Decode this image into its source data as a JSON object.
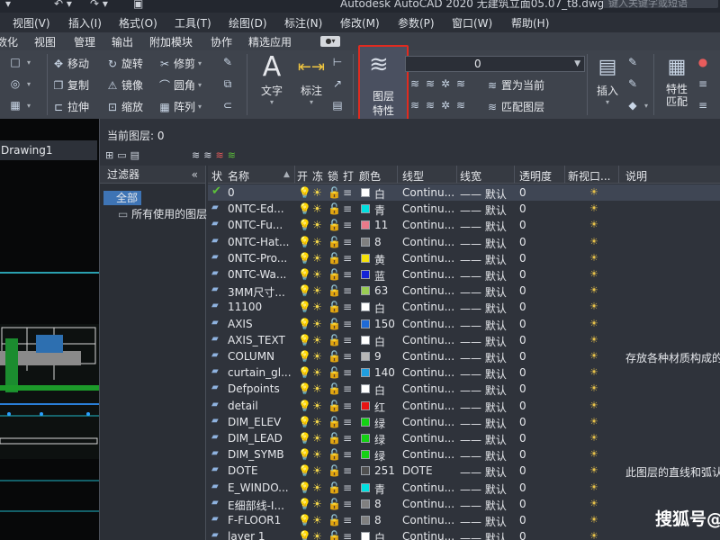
{
  "window": {
    "title": "Autodesk AutoCAD 2020    无建筑立面05.07_t8.dwg",
    "search_placeholder": "键入关键字或短语"
  },
  "menu": [
    "视图(V)",
    "插入(I)",
    "格式(O)",
    "工具(T)",
    "绘图(D)",
    "标注(N)",
    "修改(M)",
    "参数(P)",
    "窗口(W)",
    "帮助(H)"
  ],
  "ribbon_tabs": [
    "数化",
    "视图",
    "管理",
    "输出",
    "附加模块",
    "协作",
    "精选应用"
  ],
  "ribbon": {
    "modify": {
      "move": "移动",
      "rotate": "旋转",
      "trim": "修剪",
      "copy": "复制",
      "mirror": "镜像",
      "fillet": "圆角",
      "stretch": "拉伸",
      "scale": "缩放",
      "array": "阵列"
    },
    "annotation": {
      "text": "文字",
      "dimension": "标注"
    },
    "layers": {
      "layer_properties_line1": "图层",
      "layer_properties_line2": "特性",
      "layer_combo_value": "0",
      "set_current": "置为当前",
      "match_layer": "匹配图层"
    },
    "insert": "插入",
    "properties_line1": "特性",
    "properties_line2": "匹配"
  },
  "drawing_tab": "Drawing1",
  "layer_manager": {
    "current_layer": "当前图层: 0",
    "filters_header": "过滤器",
    "filter_all": "全部",
    "filter_used": "所有使用的图层",
    "columns": [
      "状",
      "名称",
      "开",
      "冻",
      "锁",
      "打",
      "颜色",
      "线型",
      "线宽",
      "透明度",
      "新视口...",
      "说明"
    ],
    "layers": [
      {
        "name": "0",
        "color": "白",
        "swatch": "#ffffff",
        "linetype": "Continu...",
        "lineweight": "—— 默认",
        "transparency": "0",
        "desc": "",
        "current": true
      },
      {
        "name": "0NTC-Ed...",
        "color": "青",
        "swatch": "#00e0e0",
        "linetype": "Continu...",
        "lineweight": "—— 默认",
        "transparency": "0",
        "desc": ""
      },
      {
        "name": "0NTC-Fu...",
        "color": "11",
        "swatch": "#e87a8a",
        "linetype": "Continu...",
        "lineweight": "—— 默认",
        "transparency": "0",
        "desc": ""
      },
      {
        "name": "0NTC-Hat...",
        "color": "8",
        "swatch": "#808080",
        "linetype": "Continu...",
        "lineweight": "—— 默认",
        "transparency": "0",
        "desc": ""
      },
      {
        "name": "0NTC-Pro...",
        "color": "黄",
        "swatch": "#f5e10a",
        "linetype": "Continu...",
        "lineweight": "—— 默认",
        "transparency": "0",
        "desc": ""
      },
      {
        "name": "0NTC-Wa...",
        "color": "蓝",
        "swatch": "#1424d6",
        "linetype": "Continu...",
        "lineweight": "—— 默认",
        "transparency": "0",
        "desc": ""
      },
      {
        "name": "3MM尺寸...",
        "color": "63",
        "swatch": "#9acd54",
        "linetype": "Continu...",
        "lineweight": "—— 默认",
        "transparency": "0",
        "desc": ""
      },
      {
        "name": "11100",
        "color": "白",
        "swatch": "#ffffff",
        "linetype": "Continu...",
        "lineweight": "—— 默认",
        "transparency": "0",
        "desc": ""
      },
      {
        "name": "AXIS",
        "color": "150",
        "swatch": "#1f6ad6",
        "linetype": "Continu...",
        "lineweight": "—— 默认",
        "transparency": "0",
        "desc": ""
      },
      {
        "name": "AXIS_TEXT",
        "color": "白",
        "swatch": "#ffffff",
        "linetype": "Continu...",
        "lineweight": "—— 默认",
        "transparency": "0",
        "desc": ""
      },
      {
        "name": "COLUMN",
        "color": "9",
        "swatch": "#b7b7b7",
        "linetype": "Continu...",
        "lineweight": "—— 默认",
        "transparency": "0",
        "desc": "存放各种材质构成的"
      },
      {
        "name": "curtain_gl...",
        "color": "140",
        "swatch": "#1f9ee0",
        "linetype": "Continu...",
        "lineweight": "—— 默认",
        "transparency": "0",
        "desc": ""
      },
      {
        "name": "Defpoints",
        "color": "白",
        "swatch": "#ffffff",
        "linetype": "Continu...",
        "lineweight": "—— 默认",
        "transparency": "0",
        "desc": ""
      },
      {
        "name": "detail",
        "color": "红",
        "swatch": "#e81414",
        "linetype": "Continu...",
        "lineweight": "—— 默认",
        "transparency": "0",
        "desc": ""
      },
      {
        "name": "DIM_ELEV",
        "color": "绿",
        "swatch": "#14d214",
        "linetype": "Continu...",
        "lineweight": "—— 默认",
        "transparency": "0",
        "desc": ""
      },
      {
        "name": "DIM_LEAD",
        "color": "绿",
        "swatch": "#14d214",
        "linetype": "Continu...",
        "lineweight": "—— 默认",
        "transparency": "0",
        "desc": ""
      },
      {
        "name": "DIM_SYMB",
        "color": "绿",
        "swatch": "#14d214",
        "linetype": "Continu...",
        "lineweight": "—— 默认",
        "transparency": "0",
        "desc": ""
      },
      {
        "name": "DOTE",
        "color": "251",
        "swatch": "#505050",
        "linetype": "DOTE",
        "lineweight": "—— 默认",
        "transparency": "0",
        "desc": "此图层的直线和弧认"
      },
      {
        "name": "E_WINDO...",
        "color": "青",
        "swatch": "#00e0e0",
        "linetype": "Continu...",
        "lineweight": "—— 默认",
        "transparency": "0",
        "desc": ""
      },
      {
        "name": "E细部线-I...",
        "color": "8",
        "swatch": "#808080",
        "linetype": "Continu...",
        "lineweight": "—— 默认",
        "transparency": "0",
        "desc": ""
      },
      {
        "name": "F-FLOOR1",
        "color": "8",
        "swatch": "#808080",
        "linetype": "Continu...",
        "lineweight": "—— 默认",
        "transparency": "0",
        "desc": ""
      },
      {
        "name": "layer 1",
        "color": "白",
        "swatch": "#ffffff",
        "linetype": "Continu...",
        "lineweight": "—— 默认",
        "transparency": "0",
        "desc": ""
      }
    ]
  },
  "watermark": "搜狐号@"
}
